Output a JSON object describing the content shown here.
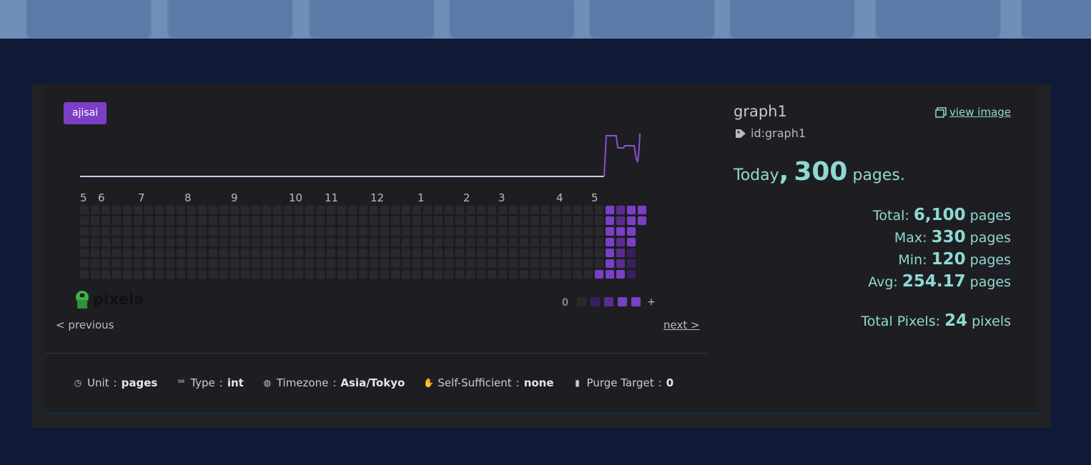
{
  "badge": "ajisai",
  "graph": {
    "months": [
      "5",
      "6",
      "7",
      "8",
      "9",
      "10",
      "11",
      "12",
      "1",
      "2",
      "3",
      "4",
      "5"
    ],
    "legend_min": "0",
    "legend_max": "+",
    "colors": {
      "empty": "#2a2a2d",
      "level1": "#3a1f5e",
      "level2": "#5a2c92",
      "level3": "#7b3fc6",
      "line": "#d9c4ea",
      "line_active": "#8a4fd6"
    },
    "logo_text": "pixela"
  },
  "nav": {
    "previous": "< previous",
    "next": "next >"
  },
  "meta": {
    "unit_label": "Unit",
    "unit_value": "pages",
    "type_label": "Type",
    "type_value": "int",
    "timezone_label": "Timezone",
    "timezone_value": "Asia/Tokyo",
    "self_sufficient_label": "Self-Sufficient",
    "self_sufficient_value": "none",
    "purge_label": "Purge Target",
    "purge_value": "0",
    "separator": ":"
  },
  "info": {
    "name": "graph1",
    "id": "id:graph1",
    "view_image": "view image",
    "today_prefix": "Today",
    "today_comma": ",",
    "today_value": "300",
    "today_unit": "pages."
  },
  "stats": {
    "total_label": "Total:",
    "total_value": "6,100",
    "max_label": "Max:",
    "max_value": "330",
    "min_label": "Min:",
    "min_value": "120",
    "avg_label": "Avg:",
    "avg_value": "254.17",
    "unit": "pages",
    "pixels_label": "Total Pixels:",
    "pixels_value": "24",
    "pixels_unit": "pixels"
  }
}
